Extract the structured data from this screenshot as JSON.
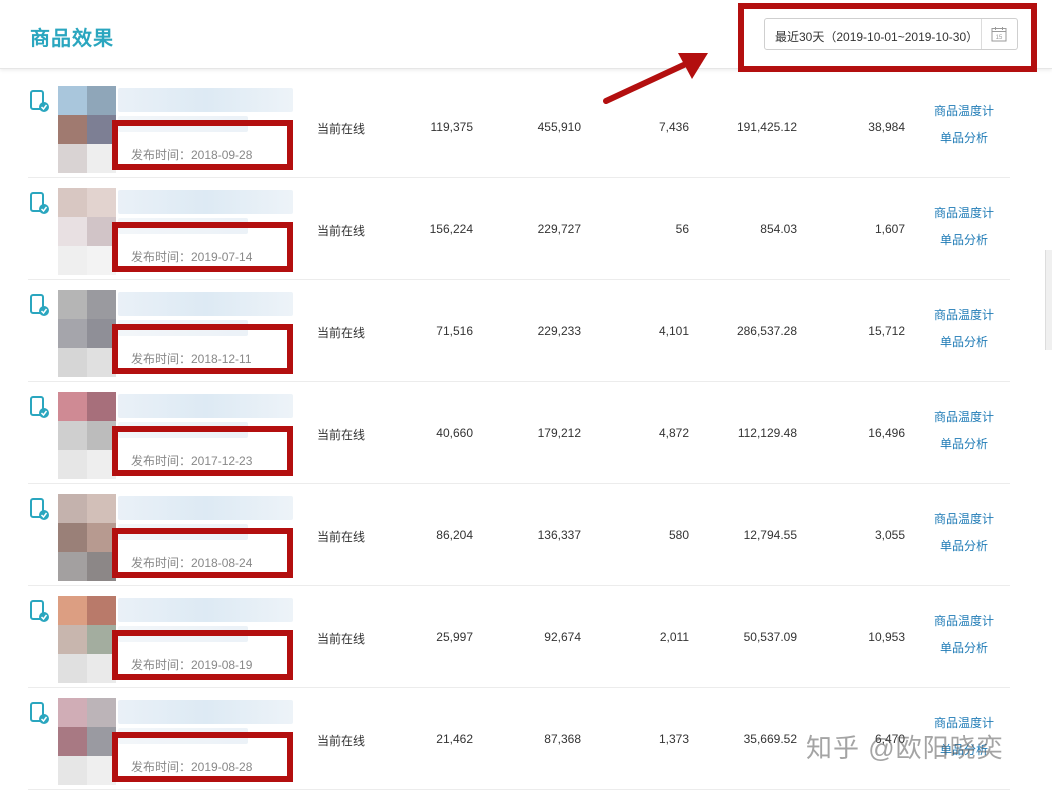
{
  "header": {
    "title": "商品效果",
    "date_range": "最近30天（2019-10-01~2019-10-30）"
  },
  "calendar_icon_number": "15",
  "rows": [
    {
      "pub": "发布时间：2018-09-28",
      "status": "当前在线",
      "v1": "119,375",
      "v2": "455,910",
      "v3": "7,436",
      "v4": "191,425.12",
      "v5": "38,984",
      "a1": "商品温度计",
      "a2": "单品分析",
      "thumb": [
        "#a9c6dc",
        "#8fa6b9",
        "#a07a70",
        "#7d7f94",
        "#d9d3d3",
        "#eeeeee"
      ]
    },
    {
      "pub": "发布时间：2019-07-14",
      "status": "当前在线",
      "v1": "156,224",
      "v2": "229,727",
      "v3": "56",
      "v4": "854.03",
      "v5": "1,607",
      "a1": "商品温度计",
      "a2": "单品分析",
      "thumb": [
        "#d8c7c2",
        "#e2d3cf",
        "#e8e0e2",
        "#d1c4c7",
        "#efefef",
        "#f3f3f3"
      ]
    },
    {
      "pub": "发布时间：2018-12-11",
      "status": "当前在线",
      "v1": "71,516",
      "v2": "229,233",
      "v3": "4,101",
      "v4": "286,537.28",
      "v5": "15,712",
      "a1": "商品温度计",
      "a2": "单品分析",
      "thumb": [
        "#b5b5b5",
        "#9a9a9f",
        "#a5a5ab",
        "#8f8f97",
        "#d6d6d6",
        "#e0e0e0"
      ]
    },
    {
      "pub": "发布时间：2017-12-23",
      "status": "当前在线",
      "v1": "40,660",
      "v2": "179,212",
      "v3": "4,872",
      "v4": "112,129.48",
      "v5": "16,496",
      "a1": "商品温度计",
      "a2": "单品分析",
      "thumb": [
        "#cf8a94",
        "#a76f7b",
        "#cfcfcf",
        "#bcbcbc",
        "#e6e6e6",
        "#eeeeee"
      ]
    },
    {
      "pub": "发布时间：2018-08-24",
      "status": "当前在线",
      "v1": "86,204",
      "v2": "136,337",
      "v3": "580",
      "v4": "12,794.55",
      "v5": "3,055",
      "a1": "商品温度计",
      "a2": "单品分析",
      "thumb": [
        "#c4b2ad",
        "#d2bfb8",
        "#9a8078",
        "#b79a90",
        "#a3a0a0",
        "#8c8787"
      ]
    },
    {
      "pub": "发布时间：2019-08-19",
      "status": "当前在线",
      "v1": "25,997",
      "v2": "92,674",
      "v3": "2,011",
      "v4": "50,537.09",
      "v5": "10,953",
      "a1": "商品温度计",
      "a2": "单品分析",
      "thumb": [
        "#dc9e82",
        "#b97a6a",
        "#c8b6ae",
        "#a3ad9f",
        "#e0e0e0",
        "#eaeaea"
      ]
    },
    {
      "pub": "发布时间：2019-08-28",
      "status": "当前在线",
      "v1": "21,462",
      "v2": "87,368",
      "v3": "1,373",
      "v4": "35,669.52",
      "v5": "6,470",
      "a1": "商品温度计",
      "a2": "单品分析",
      "thumb": [
        "#d0adb6",
        "#bcb4b8",
        "#a87983",
        "#9a9aa1",
        "#e6e6e6",
        "#efefef"
      ]
    }
  ],
  "watermark": "知乎 @欧阳晓奕"
}
